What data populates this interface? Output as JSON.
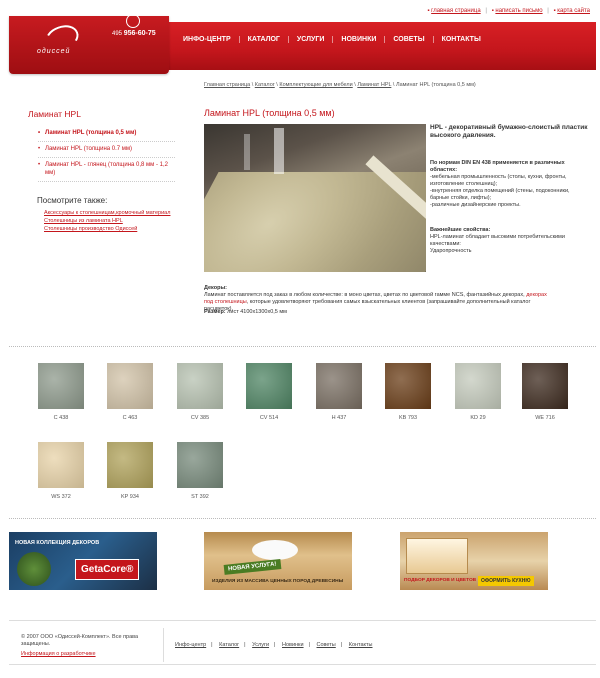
{
  "top_links": [
    "главная страница",
    "написать письмо",
    "карта сайта"
  ],
  "header": {
    "logo_text": "одиссей",
    "phone_prefix": "495",
    "phone_number": "956-60-75",
    "nav": [
      "ИНФО-ЦЕНТР",
      "КАТАЛОГ",
      "УСЛУГИ",
      "НОВИНКИ",
      "СОВЕТЫ",
      "КОНТАКТЫ"
    ]
  },
  "breadcrumb": {
    "links": [
      "Главная страница",
      "Каталог",
      "Комплектующие для мебели",
      "Ламинат HPL"
    ],
    "current": "Ламинат HPL (толщина 0,5 мм)"
  },
  "sidebar": {
    "title": "Ламинат HPL",
    "items": [
      {
        "label": "Ламинат HPL (толщина 0,5 мм)",
        "active": true
      },
      {
        "label": "Ламинат HPL (толщина 0.7 мм)",
        "active": false
      },
      {
        "label": "Ламинат HPL - глянец (толщина 0,8 мм - 1,2 мм)",
        "active": false
      }
    ],
    "see_also_title": "Посмотрите также:",
    "see_also": [
      "Аксессуары к столешницам,кромочный материал",
      "Столешницы из ламината HPL",
      "Столешницы производство Одиссей"
    ]
  },
  "main": {
    "title": "Ламинат HPL (толщина 0,5 мм)",
    "desc_head": "HPL - декоративный бумажно-слоистый пластик высокого давления.",
    "areas_title": "По нормам DIN EN 438 применяется в различных областях:",
    "areas": [
      "-мебельная промышленность (столы, кухни, фронты, изготовление столешниц);",
      "-внутренняя отделка помещений (стены, подоконники, барные стойки, лифты);",
      "-различные дизайнерские проекты."
    ],
    "props_title": "Важнейшие свойства:",
    "props": [
      "HPL-ламинат обладает высокими потребительскими качествами:",
      "Ударопрочность"
    ],
    "decor_title": "Декоры:",
    "decor_text_1": "Ламинат поставляется под заказ в любом количестве: в моно цветах, цветах по цветовой гамме NCS, фантазийных декорах,",
    "decor_link": "декорах под столешницы",
    "decor_text_2": ", которые удовлетворяют требования самых взыскательных клиентов (запрашивайте дополнительный каталог расцветок).",
    "size_label": "Размер:",
    "size_value": "лист 4100х1300х0,5 мм"
  },
  "swatches": [
    {
      "code": "C 438",
      "color": "#8e9a8c"
    },
    {
      "code": "C 463",
      "color": "#d2c3a8"
    },
    {
      "code": "CV 385",
      "color": "#b7c2b1"
    },
    {
      "code": "CV 514",
      "color": "#4f8564"
    },
    {
      "code": "H 437",
      "color": "#7a6f63"
    },
    {
      "code": "KB 793",
      "color": "#6a3d17"
    },
    {
      "code": "KD 29",
      "color": "#c5cbbd"
    },
    {
      "code": "WE 716",
      "color": "#3d2a1e"
    },
    {
      "code": "WS 372",
      "color": "#e8d3a8"
    },
    {
      "code": "KP 934",
      "color": "#b0a25a"
    },
    {
      "code": "ST 392",
      "color": "#778a7b"
    }
  ],
  "banners": {
    "b1_title": "НОВАЯ КОЛЛЕКЦИЯ ДЕКОРОВ",
    "b1_logo": "GetaCore®",
    "b2_badge": "НОВАЯ УСЛУГА!",
    "b2_text": "ИЗДЕЛИЯ ИЗ МАССИВА ЦЕННЫХ ПОРОД ДРЕВЕСИНЫ",
    "b3_text": "ПОДБОР ДЕКОРОВ И ЦВЕТОВ",
    "b3_badge": "ОФОРМИТЬ КУХНЮ"
  },
  "footer": {
    "copyright": "© 2007 ООО «Одиссей-Комплект». Все права защищены.",
    "developer": "Информация о разработчике",
    "nav": [
      "Инфо-центр",
      "Каталог",
      "Услуги",
      "Новинки",
      "Советы",
      "Контакты"
    ]
  }
}
